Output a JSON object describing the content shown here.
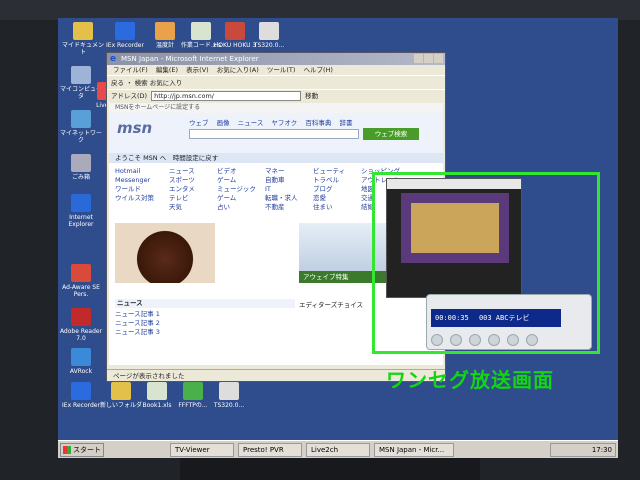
{
  "desktop_icons": [
    {
      "label": "マイドキュメント"
    },
    {
      "label": "IEx Recorder"
    },
    {
      "label": "温度計"
    },
    {
      "label": "作業コード.xls"
    },
    {
      "label": "HOKU HOKU 3"
    },
    {
      "label": "TS320.0..."
    },
    {
      "label": "マイコンピュータ"
    },
    {
      "label": "Live2..."
    },
    {
      "label": "マイネットワーク"
    },
    {
      "label": "ごみ箱"
    },
    {
      "label": "Internet Explorer"
    },
    {
      "label": "Ad-Aware SE Pers."
    },
    {
      "label": "Adobe Reader 7.0"
    },
    {
      "label": "AVRock"
    }
  ],
  "bottom_icons": [
    {
      "label": "IEx Recorder"
    },
    {
      "label": "新しいフォルダ"
    },
    {
      "label": "Book1.xls"
    },
    {
      "label": "FFFTPの..."
    },
    {
      "label": "TS320.0..."
    }
  ],
  "ie": {
    "title": "MSN Japan - Microsoft Internet Explorer",
    "menu": [
      "ファイル(F)",
      "編集(E)",
      "表示(V)",
      "お気に入り(A)",
      "ツール(T)",
      "ヘルプ(H)"
    ],
    "toolbar": "戻る ・ 検索 お気に入り",
    "address_label": "アドレス(D)",
    "address": "http://jp.msn.com/",
    "go": "移動",
    "status": "ページが表示されました"
  },
  "msn": {
    "topbar": "MSNをホームページに設定する",
    "logo": "msn",
    "nav": [
      "ウェブ",
      "画像",
      "ニュース",
      "ヤフオク",
      "百科事典",
      "辞書"
    ],
    "search_button": "ウェブ検索",
    "welcome": "ようこそ MSN へ　時間設定に戻す",
    "col1": [
      "Hotmail",
      "Messenger",
      "ワールド",
      "ウイルス対策"
    ],
    "col2": [
      "ニュース",
      "スポーツ",
      "エンタメ",
      "テレビ",
      "天気"
    ],
    "col3": [
      "ビデオ",
      "ゲーム",
      "ミュージック",
      "ゲーム",
      "占い"
    ],
    "col4": [
      "マネー",
      "自動車",
      "IT",
      "転職・求人",
      "不動産"
    ],
    "col5": [
      "ビューティ",
      "トラベル",
      "ブログ",
      "恋愛",
      "住まい"
    ],
    "col6": [
      "ショッピング",
      "アウトレット",
      "地図",
      "交通",
      "結婚"
    ],
    "car_label": "アウェイブ特集",
    "news_heading": "ニュース",
    "news": [
      "ニュース記事 1",
      "ニュース記事 2",
      "ニュース記事 3"
    ],
    "editor": "エディターズチョイス"
  },
  "player": {
    "time": "00:00:35",
    "channel": "003 ABCテレビ"
  },
  "caption": "ワンセグ放送画面",
  "taskbar": {
    "start": "スタート",
    "items": [
      "TV-Viewer",
      "Presto! PVR",
      "Live2ch",
      "MSN Japan - Micr..."
    ],
    "clock": "17:30"
  },
  "colors": {
    "highlight": "#32e632",
    "caption": "#12d612",
    "desktop": "#2f4d8c"
  }
}
